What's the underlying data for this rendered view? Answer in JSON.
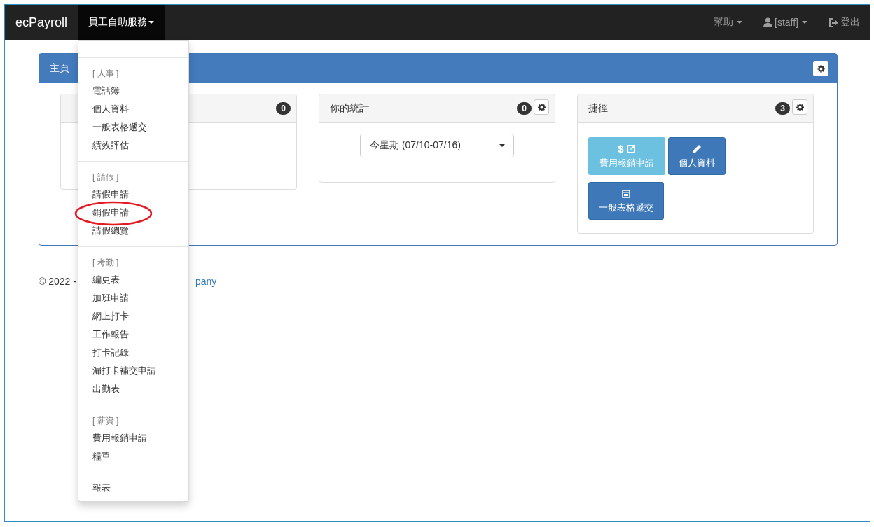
{
  "navbar": {
    "brand": "ecPayroll",
    "menu": {
      "label": "員工自助服務",
      "expanded": true
    },
    "right": [
      {
        "kind": "help",
        "label": "幫助"
      },
      {
        "kind": "user",
        "label": "[staff]"
      },
      {
        "kind": "logout",
        "label": "登出"
      }
    ]
  },
  "dropdown": {
    "sections": [
      {
        "header": "[ 人事 ]",
        "items": [
          {
            "label": "電話簿",
            "circled": false
          },
          {
            "label": "個人資料",
            "circled": false
          },
          {
            "label": "一般表格遞交",
            "circled": false
          },
          {
            "label": "績效評估",
            "circled": false
          }
        ]
      },
      {
        "header": "[ 請假 ]",
        "items": [
          {
            "label": "請假申請",
            "circled": false
          },
          {
            "label": "銷假申請",
            "circled": true
          },
          {
            "label": "請假總覽",
            "circled": false
          }
        ]
      },
      {
        "header": "[ 考勤 ]",
        "items": [
          {
            "label": "編更表",
            "circled": false
          },
          {
            "label": "加班申請",
            "circled": false
          },
          {
            "label": "網上打卡",
            "circled": false
          },
          {
            "label": "工作報告",
            "circled": false
          },
          {
            "label": "打卡記錄",
            "circled": false
          },
          {
            "label": "漏打卡補交申請",
            "circled": false
          },
          {
            "label": "出勤表",
            "circled": false
          }
        ]
      },
      {
        "header": "[ 薪資 ]",
        "items": [
          {
            "label": "費用報銷申請",
            "circled": false
          },
          {
            "label": "糧單",
            "circled": false
          }
        ]
      },
      {
        "items": [
          {
            "label": "報表",
            "circled": false
          }
        ]
      }
    ]
  },
  "panel": {
    "title": "主頁"
  },
  "widgets": [
    {
      "kind": "text",
      "badge": "0",
      "gear": false
    },
    {
      "kind": "select",
      "title": "你的統計",
      "badge": "0",
      "gear": true,
      "select": "今星期 (07/10-07/16)"
    },
    {
      "kind": "shortcuts",
      "title": "捷徑",
      "badge": "3",
      "gear": true,
      "shortcuts": [
        {
          "symbol": "$",
          "label": "費用報銷申請"
        },
        {
          "label": "個人資料"
        },
        {
          "label": "一般表格遞交"
        }
      ]
    }
  ],
  "footer": {
    "text": "© 2022 -",
    "link": "pany"
  }
}
